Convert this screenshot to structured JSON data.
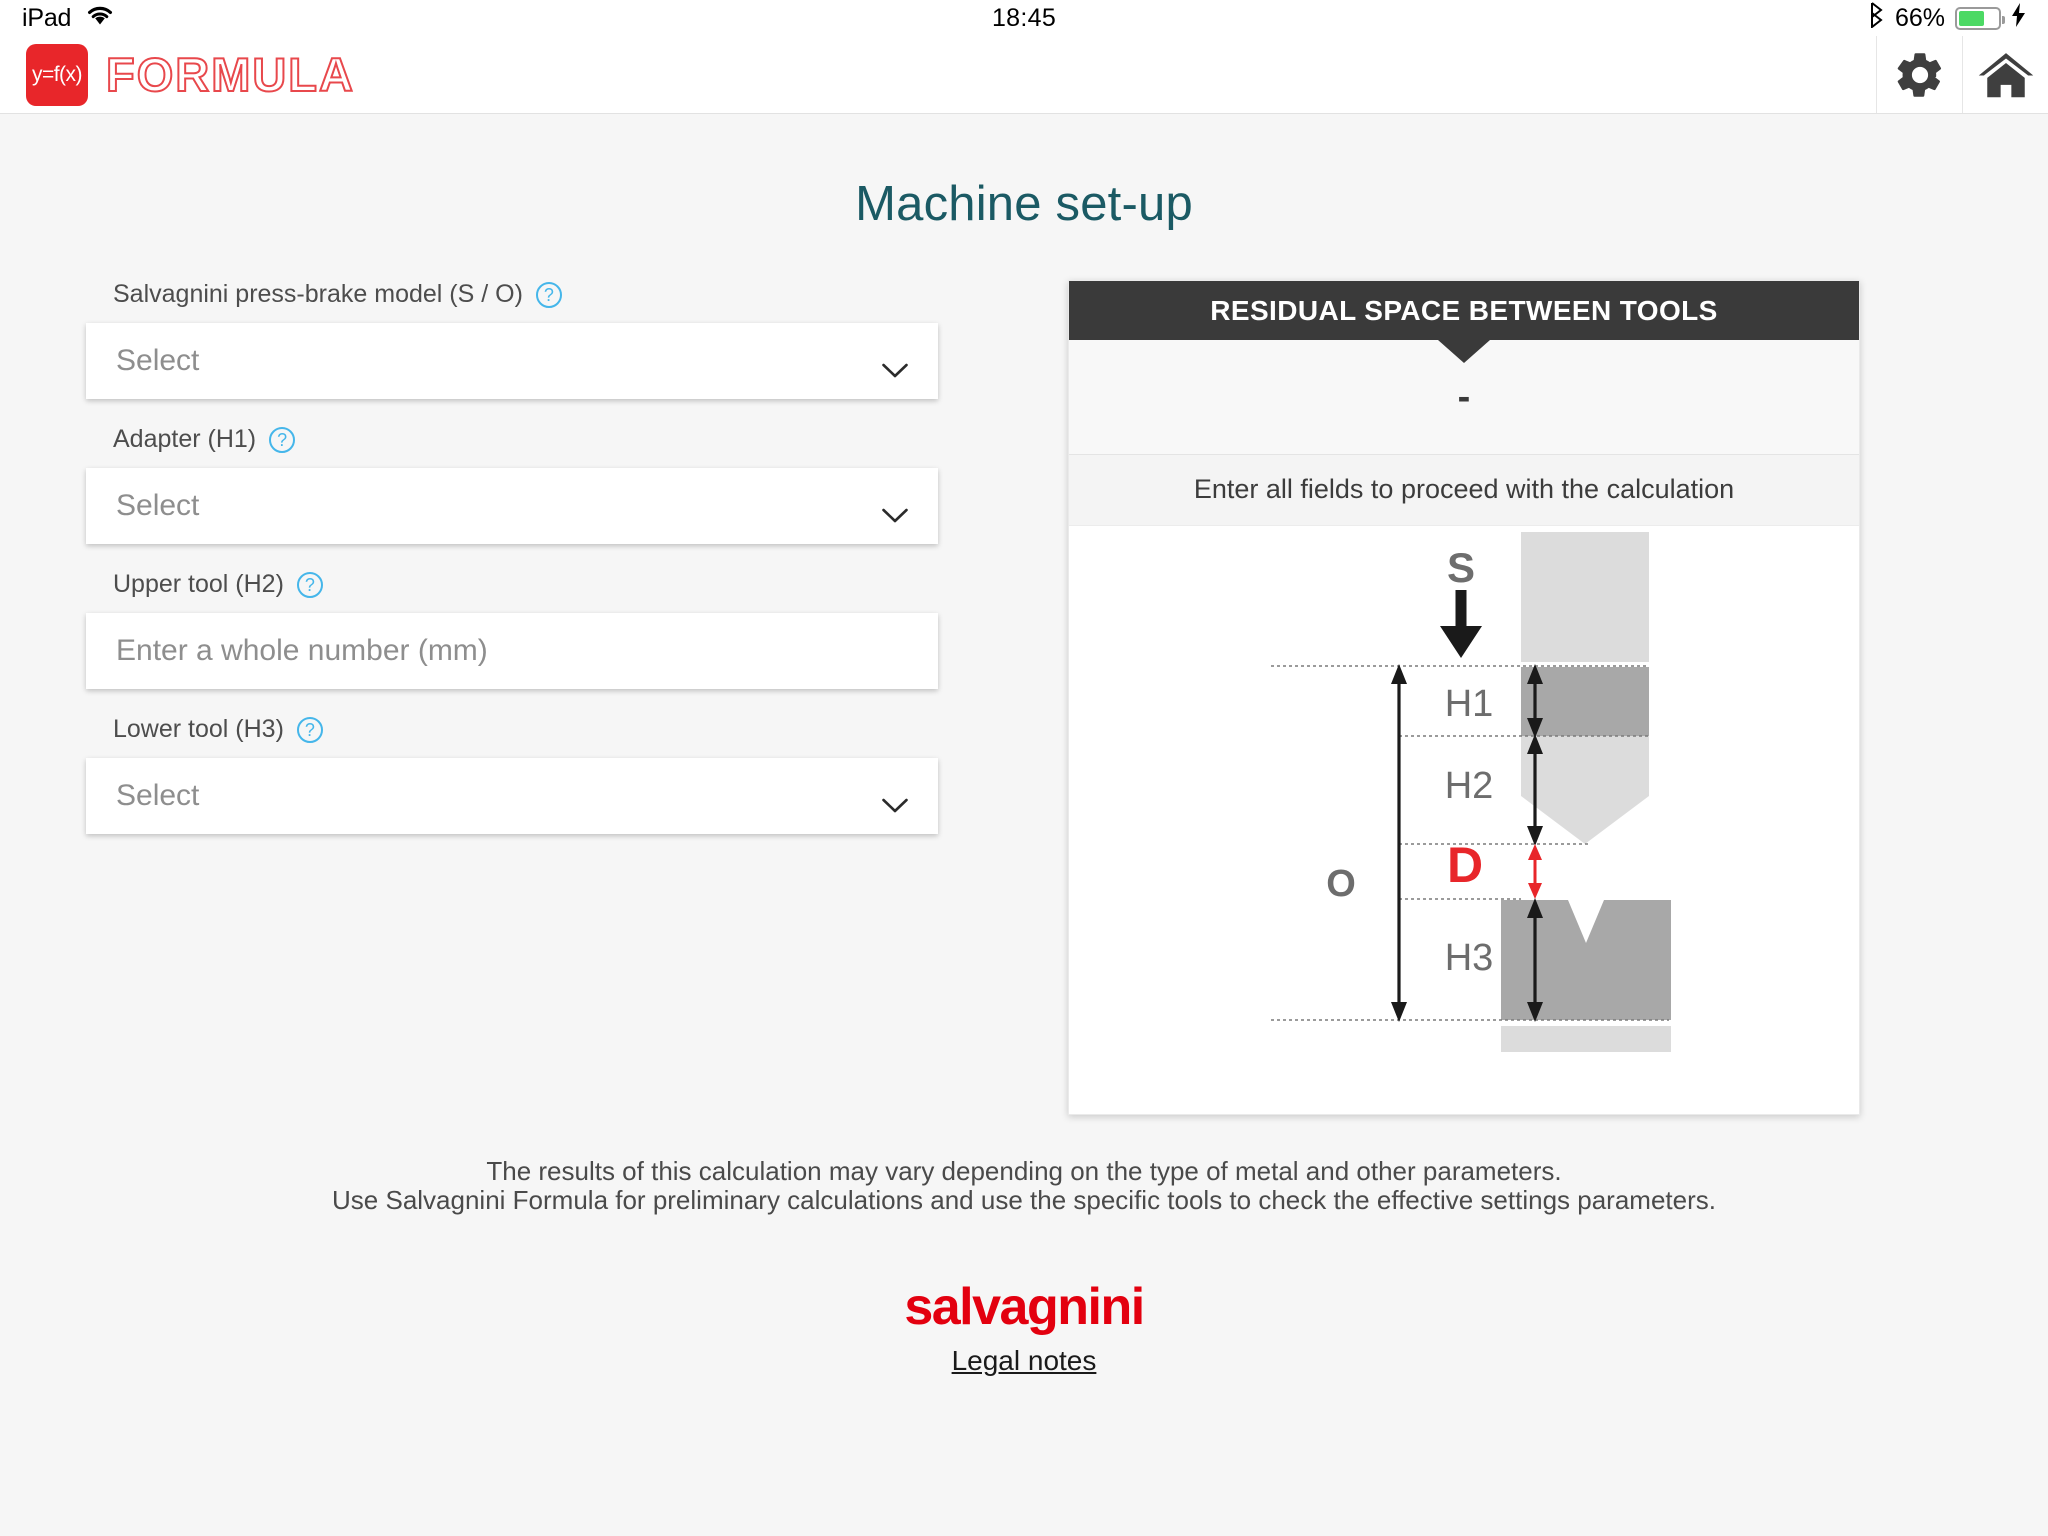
{
  "status_bar": {
    "device": "iPad",
    "wifi_icon": "wifi-icon",
    "time": "18:45",
    "bluetooth_icon": "bluetooth-icon",
    "battery_percent": "66%",
    "battery_level": 66,
    "battery_color": "#4cd964",
    "charging_icon": "lightning-bolt-icon"
  },
  "header": {
    "badge_text": "y=f(x)",
    "brand_name": "FORMULA",
    "brand_color": "#e8262a",
    "settings_icon": "gear-icon",
    "home_icon": "home-icon"
  },
  "main": {
    "page_title": "Machine set-up",
    "title_color": "#1b5a64"
  },
  "form": {
    "help_glyph": "?",
    "chevron_icon": "chevron-down-icon",
    "fields": [
      {
        "label": "Salvagnini press-brake model (S / O)",
        "type": "select",
        "placeholder": "Select",
        "value": ""
      },
      {
        "label": "Adapter (H1)",
        "type": "select",
        "placeholder": "Select",
        "value": ""
      },
      {
        "label": "Upper tool (H2)",
        "type": "text",
        "placeholder": "Enter a whole number (mm)",
        "value": ""
      },
      {
        "label": "Lower tool (H3)",
        "type": "select",
        "placeholder": "Select",
        "value": ""
      }
    ]
  },
  "result_panel": {
    "title": "RESIDUAL SPACE BETWEEN TOOLS",
    "title_bg": "#3a3a3a",
    "result_value": "-",
    "message": "Enter all fields to proceed with the calculation",
    "diagram": {
      "labels": {
        "stroke": "S",
        "adapter": "H1",
        "upper_tool": "H2",
        "residual": "D",
        "lower_tool": "H3",
        "opening": "O"
      },
      "highlight_color": "#e8262a",
      "label_color": "#6d6d6d",
      "part_colors": {
        "ram": "#dcdcdc",
        "adapter": "#a8a8a8",
        "upper_tool": "#dcdcdc",
        "lower_die": "#a8a8a8",
        "base": "#dcdcdc"
      }
    }
  },
  "footer": {
    "disclaimer_line_1": "The results of this calculation may vary depending on the type of metal and other parameters.",
    "disclaimer_line_2": "Use Salvagnini Formula for preliminary calculations and use the specific tools to check the effective settings parameters.",
    "company": "salvagnini",
    "company_color": "#e3000f",
    "legal_link": "Legal notes"
  }
}
